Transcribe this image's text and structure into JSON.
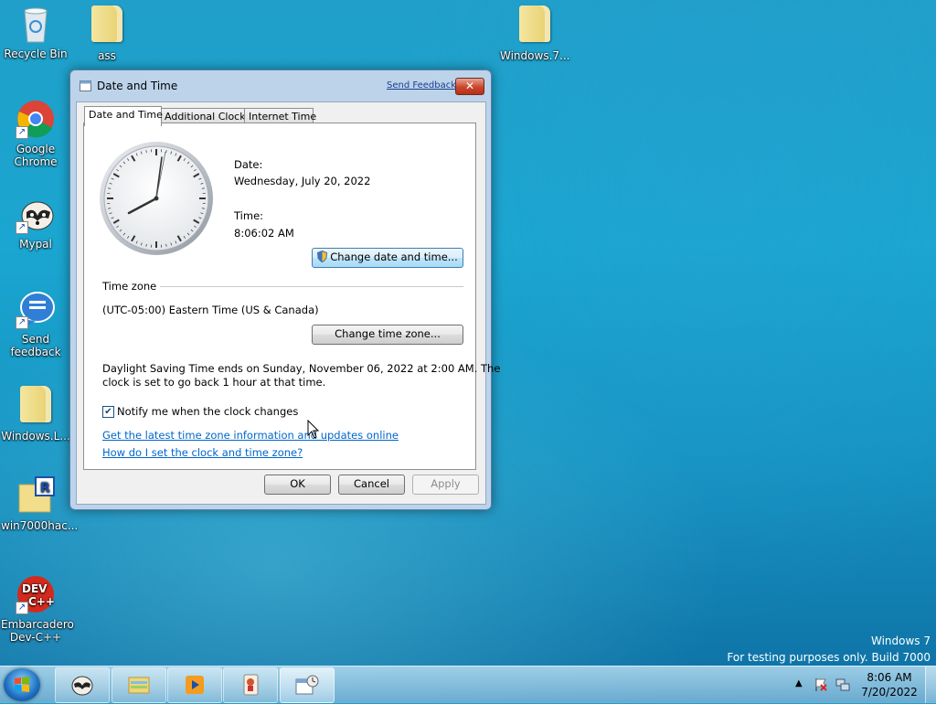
{
  "desktop": {
    "icons": [
      {
        "label": "Recycle Bin"
      },
      {
        "label": "ass"
      },
      {
        "label": "Windows.7..."
      },
      {
        "label": "Google Chrome"
      },
      {
        "label": "Mypal"
      },
      {
        "label": "Send feedback"
      },
      {
        "label": "Windows.L..."
      },
      {
        "label": "win7000hac..."
      },
      {
        "label": "Embarcadero Dev-C++"
      }
    ],
    "watermark": {
      "line1": "Windows 7",
      "line2": "For testing purposes only. Build 7000"
    }
  },
  "dialog": {
    "title": "Date and Time",
    "send_feedback": "Send Feedback",
    "close_glyph": "✕",
    "tabs": [
      {
        "label": "Date and Time",
        "active": true
      },
      {
        "label": "Additional Clocks",
        "active": false
      },
      {
        "label": "Internet Time",
        "active": false
      }
    ],
    "date_label": "Date:",
    "date_value": "Wednesday, July 20, 2022",
    "time_label": "Time:",
    "time_value": "8:06:02 AM",
    "change_datetime_button": "Change date and time...",
    "timezone_group": "Time zone",
    "timezone_value": "(UTC-05:00) Eastern Time (US & Canada)",
    "change_timezone_button": "Change time zone...",
    "dst_line1": "Daylight Saving Time ends on Sunday, November 06, 2022 at 2:00 AM. The",
    "dst_line2": "clock is set to go back 1 hour at that time.",
    "notify_checkbox": {
      "label": "Notify me when the clock changes",
      "checked": true
    },
    "link1": "Get the latest time zone information and updates online",
    "link2": "How do I set the clock and time zone?",
    "ok": "OK",
    "cancel": "Cancel",
    "apply": "Apply"
  },
  "taskbar": {
    "clock_time": "8:06 AM",
    "clock_date": "7/20/2022",
    "tray_icons": [
      "show-hidden-icons",
      "action-center-flag-icon",
      "network-icon"
    ],
    "pinned": [
      "mypal-icon",
      "explorer-icon",
      "media-player-icon",
      "game-icon",
      "date-time-icon"
    ]
  },
  "colors": {
    "link": "#0066cc",
    "desktop": "#1aa6d0",
    "close": "#c9462c"
  }
}
